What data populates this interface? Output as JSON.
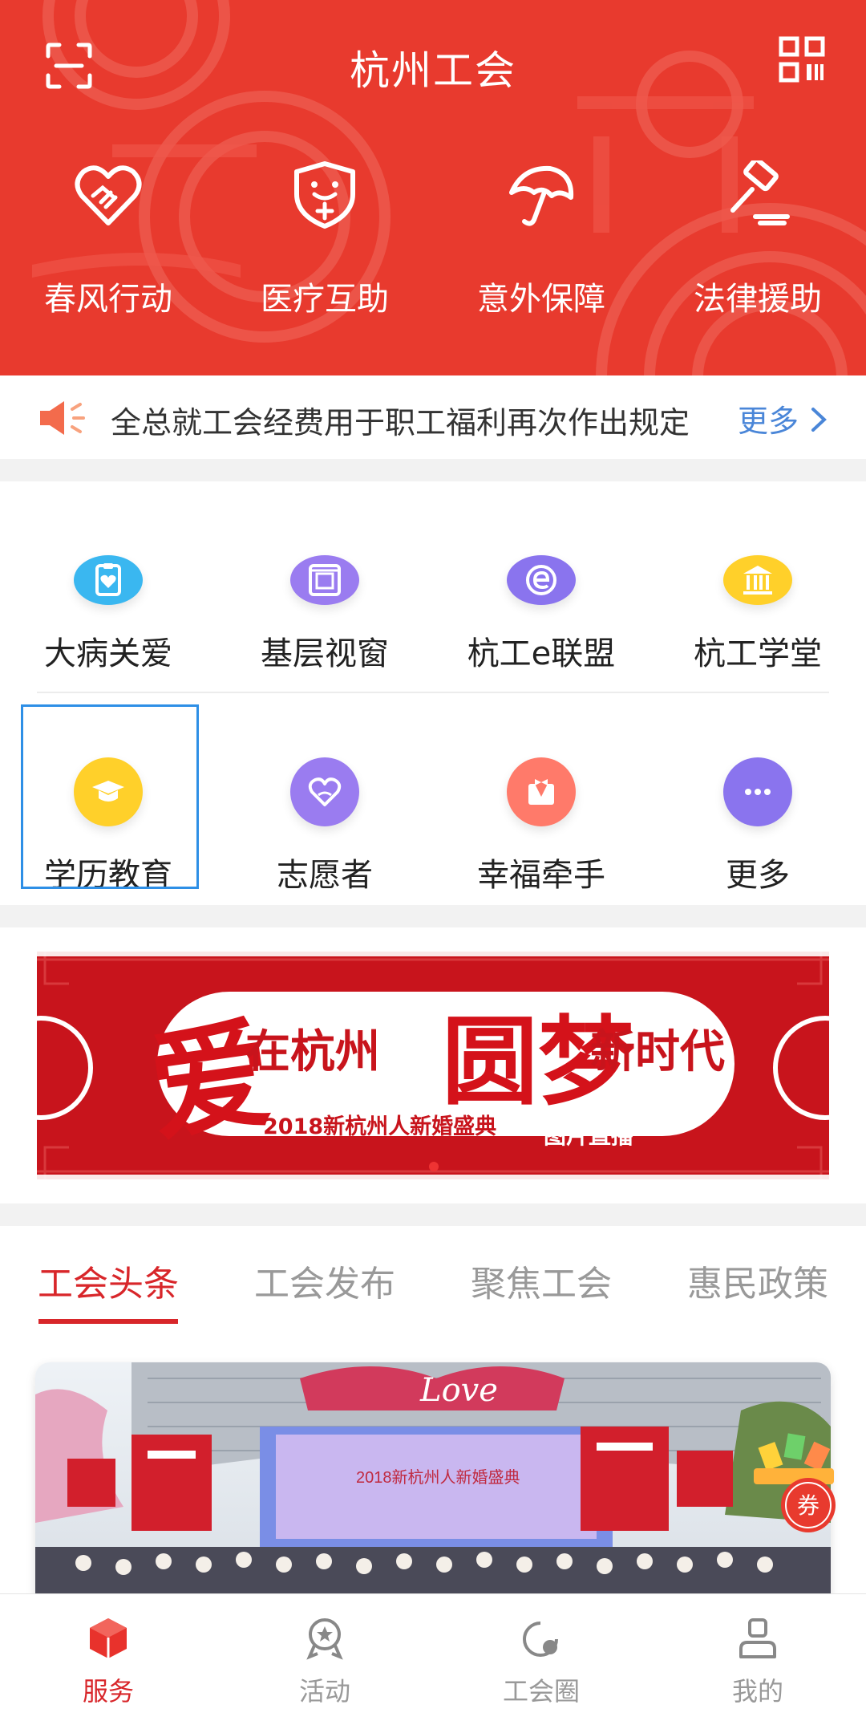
{
  "app": {
    "title": "杭州工会"
  },
  "quick_actions": [
    {
      "label": "春风行动",
      "icon": "heart-handshake-icon"
    },
    {
      "label": "医疗互助",
      "icon": "medical-shield-icon"
    },
    {
      "label": "意外保障",
      "icon": "umbrella-icon"
    },
    {
      "label": "法律援助",
      "icon": "gavel-icon"
    }
  ],
  "notice": {
    "text": "全总就工会经费用于职工福利再次作出规定",
    "more": "更多"
  },
  "services_row1": [
    {
      "label": "大病关爱",
      "icon": "care-clipboard-icon",
      "color": "#3ab7f0"
    },
    {
      "label": "基层视窗",
      "icon": "window-icon",
      "color": "#9a7cf0"
    },
    {
      "label": "杭工e联盟",
      "icon": "e-alliance-icon",
      "color": "#8a74ee"
    },
    {
      "label": "杭工学堂",
      "icon": "school-building-icon",
      "color": "#ffd02a"
    }
  ],
  "services_row2": [
    {
      "label": "学历教育",
      "icon": "graduation-cap-icon",
      "color": "#ffd02a"
    },
    {
      "label": "志愿者",
      "icon": "volunteer-heart-icon",
      "color": "#9a7cf0"
    },
    {
      "label": "幸福牵手",
      "icon": "bowtie-suit-icon",
      "color": "#ff7a6a"
    },
    {
      "label": "更多",
      "icon": "more-dots-icon",
      "color": "#8a74ee"
    }
  ],
  "banner": {
    "big_char_1": "爱",
    "line1": "在杭州",
    "big_char_2": "圆梦",
    "line1b": "新时代",
    "line2": "2018新杭州人新婚盛典",
    "tag": "图片直播"
  },
  "tabs": [
    "工会头条",
    "工会发布",
    "聚焦工会",
    "惠民政策"
  ],
  "photo": {
    "love_sign": "Love",
    "stage_title": "2018新杭州人新婚盛典"
  },
  "coupon": {
    "label": "券"
  },
  "bottom_nav": [
    {
      "label": "服务",
      "icon": "service-cube-icon",
      "active": true
    },
    {
      "label": "活动",
      "icon": "activity-medal-icon",
      "active": false
    },
    {
      "label": "工会圈",
      "icon": "circle-icon",
      "active": false
    },
    {
      "label": "我的",
      "icon": "profile-icon",
      "active": false
    }
  ],
  "colors": {
    "brand_red": "#e83a2e",
    "active_red": "#d8262a",
    "link_blue": "#4a86d8",
    "selected_border": "#2e8fe6"
  }
}
